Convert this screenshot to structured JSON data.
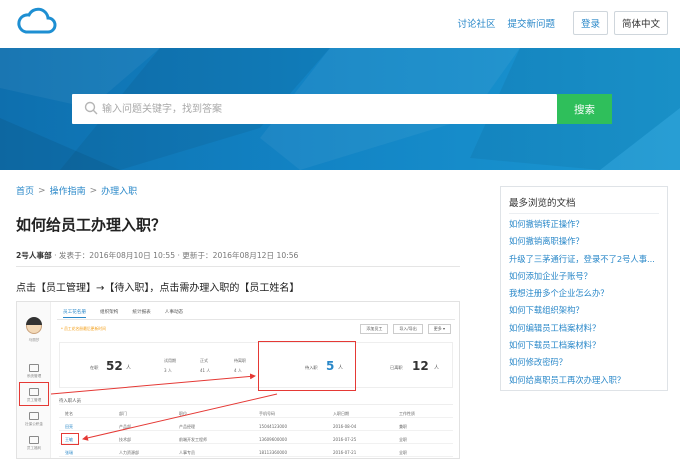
{
  "header": {
    "logo": "cloud-logo",
    "links": [
      "讨论社区",
      "提交新问题"
    ],
    "login_label": "登录",
    "lang_label": "简体中文"
  },
  "search": {
    "placeholder": "输入问题关键字，找到答案",
    "button_label": "搜索"
  },
  "breadcrumb": [
    "首页",
    "操作指南",
    "办理入职"
  ],
  "article": {
    "title": "如何给员工办理入职？",
    "author": "2号人事部",
    "published": "· 发表于：2016年08月10日 10:55",
    "updated": "· 更新于：2016年08月12日 10:56",
    "paragraph": "点击【员工管理】→【待入职】，点击需办理入职的【员工姓名】"
  },
  "screenshot": {
    "sidebar_labels": [
      "系统管理",
      "员工管理",
      "社保公积金",
      "员工福利"
    ],
    "user_label": "马丽莎",
    "tabs": [
      "员工花名册",
      "组织架构",
      "统计报表",
      "人事动态"
    ],
    "note": "* 员工花名册最后更新时间",
    "buttons": [
      "添加员工",
      "导入/导出",
      "更多 ▾"
    ],
    "stats": {
      "onjob_label": "在职",
      "onjob_count": "52",
      "unit": "人",
      "trial_label": "试用期",
      "trial_count": "3 人",
      "formal_label": "正式",
      "formal_count": "41 人",
      "leave_label": "待离职",
      "leave_count": "4 人",
      "pending_label": "待入职",
      "pending_count": "5",
      "left_label": "已离职",
      "left_count": "12"
    },
    "section_label": "待入职人员",
    "columns": [
      "姓名",
      "部门",
      "职位",
      "手机号码",
      "入职日期",
      "工作性质"
    ],
    "rows": [
      [
        "田亮",
        "产品部",
        "产品经理",
        "15044123000",
        "2016-08-04",
        "兼职"
      ],
      [
        "王敏",
        "技术部",
        "前端开发工程师",
        "13609600000",
        "2016-07-25",
        "全职"
      ],
      [
        "张瑞",
        "人力资源部",
        "人事专员",
        "18113360000",
        "2016-07-21",
        "全职"
      ]
    ]
  },
  "sidebar": {
    "title": "最多浏览的文档",
    "items": [
      "如何撤销转正操作？",
      "如何撤销离职操作？",
      "升级了三茅通行证，登录不了2号人事...",
      "如何添加企业子账号？",
      "我想注册多个企业怎么办？",
      "如何下载组织架构？",
      "如何编辑员工档案材料？",
      "如何下载员工档案材料？",
      "如何修改密码？",
      "如何给离职员工再次办理入职？"
    ]
  },
  "colors": {
    "accent": "#2a88c9",
    "search_button": "#2fbf5b",
    "hero": "#1283c4",
    "highlight": "#e53935"
  }
}
